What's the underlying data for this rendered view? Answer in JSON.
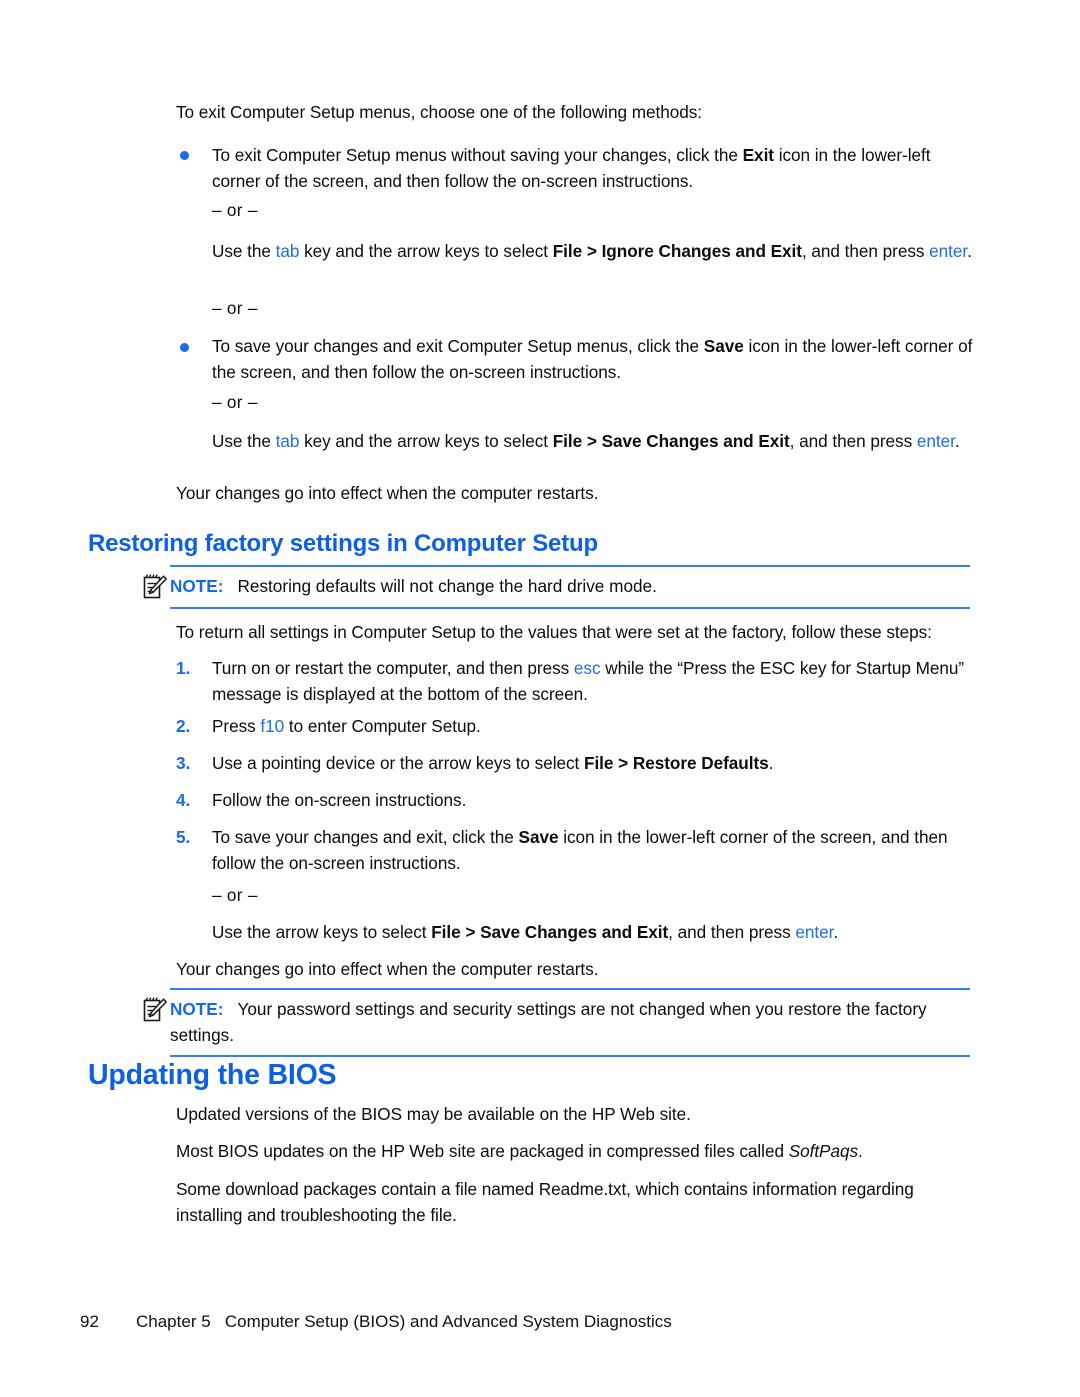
{
  "colors": {
    "heading_blue": "#0d5fe6",
    "keyword_blue": "#1f6fe0",
    "note_rule_blue": "#2f7ff0",
    "bullet_blue": "#1a6ae8",
    "body_black": "#0d0d0d"
  },
  "intro": {
    "lead": "To exit Computer Setup menus, choose one of the following methods:"
  },
  "bullets": [
    {
      "text_before": "To exit Computer Setup menus without saving your changes, click the ",
      "bold": "Exit",
      "text_after": " icon in the lower-left corner of the screen, and then follow the on-screen instructions."
    },
    {
      "text_before": "To save your changes and exit Computer Setup menus, click the ",
      "bold": "Save",
      "text_after": " icon in the lower-left corner of the screen, and then follow the on-screen instructions."
    }
  ],
  "or_separator": "– or –",
  "alt_instructions": [
    {
      "prefix": "Use the ",
      "key1": "tab",
      "middle": " key and the arrow keys to select ",
      "bold": "File > Ignore Changes and Exit",
      "suffix": ", and then press ",
      "key2": "enter",
      "end": "."
    },
    {
      "prefix": "Use the ",
      "key1": "tab",
      "middle": " key and the arrow keys to select ",
      "bold": "File > Save Changes and Exit",
      "suffix": ", and then press ",
      "key2": "enter",
      "end": "."
    }
  ],
  "effect_note": "Your changes go into effect when the computer restarts.",
  "section_restore": {
    "heading": "Restoring factory settings in Computer Setup",
    "note1": {
      "label": "NOTE:",
      "text": "Restoring defaults will not change the hard drive mode.",
      "icon": "note-pencil-icon"
    },
    "lead": "To return all settings in Computer Setup to the values that were set at the factory, follow these steps:",
    "steps": [
      {
        "number": "1.",
        "part1": "Turn on or restart the computer, and then press ",
        "key": "esc",
        "part2": " while the “Press the ESC key for Startup Menu” message is displayed at the bottom of the screen."
      },
      {
        "number": "2.",
        "part1": "Press ",
        "key": "f10",
        "part2": " to enter Computer Setup."
      },
      {
        "number": "3.",
        "part1": "Use a pointing device or the arrow keys to select ",
        "bold": "File > Restore Defaults",
        "part2": "."
      },
      {
        "number": "4.",
        "part1": "Follow the on-screen instructions."
      },
      {
        "number": "5.",
        "part1": "To save your changes and exit, click the ",
        "bold": "Save",
        "part2": " icon in the lower-left corner of the screen, and then follow the on-screen instructions."
      }
    ],
    "step5_alt": {
      "prefix": "Use the arrow keys to select ",
      "bold": "File > Save Changes and Exit",
      "suffix": ", and then press ",
      "key": "enter",
      "end": "."
    },
    "note2": {
      "label": "NOTE:",
      "text": "Your password settings and security settings are not changed when you restore the factory settings.",
      "icon": "note-pencil-icon"
    }
  },
  "section_bios": {
    "heading": "Updating the BIOS",
    "paragraphs": [
      {
        "text": "Updated versions of the BIOS may be available on the HP Web site."
      },
      {
        "prefix": "Most BIOS updates on the HP Web site are packaged in compressed files called ",
        "italic": "SoftPaqs",
        "suffix": "."
      },
      {
        "text": "Some download packages contain a file named Readme.txt, which contains information regarding installing and troubleshooting the file."
      }
    ]
  },
  "footer": {
    "page_number": "92",
    "chapter": "Chapter 5",
    "title": "Computer Setup (BIOS) and Advanced System Diagnostics"
  }
}
